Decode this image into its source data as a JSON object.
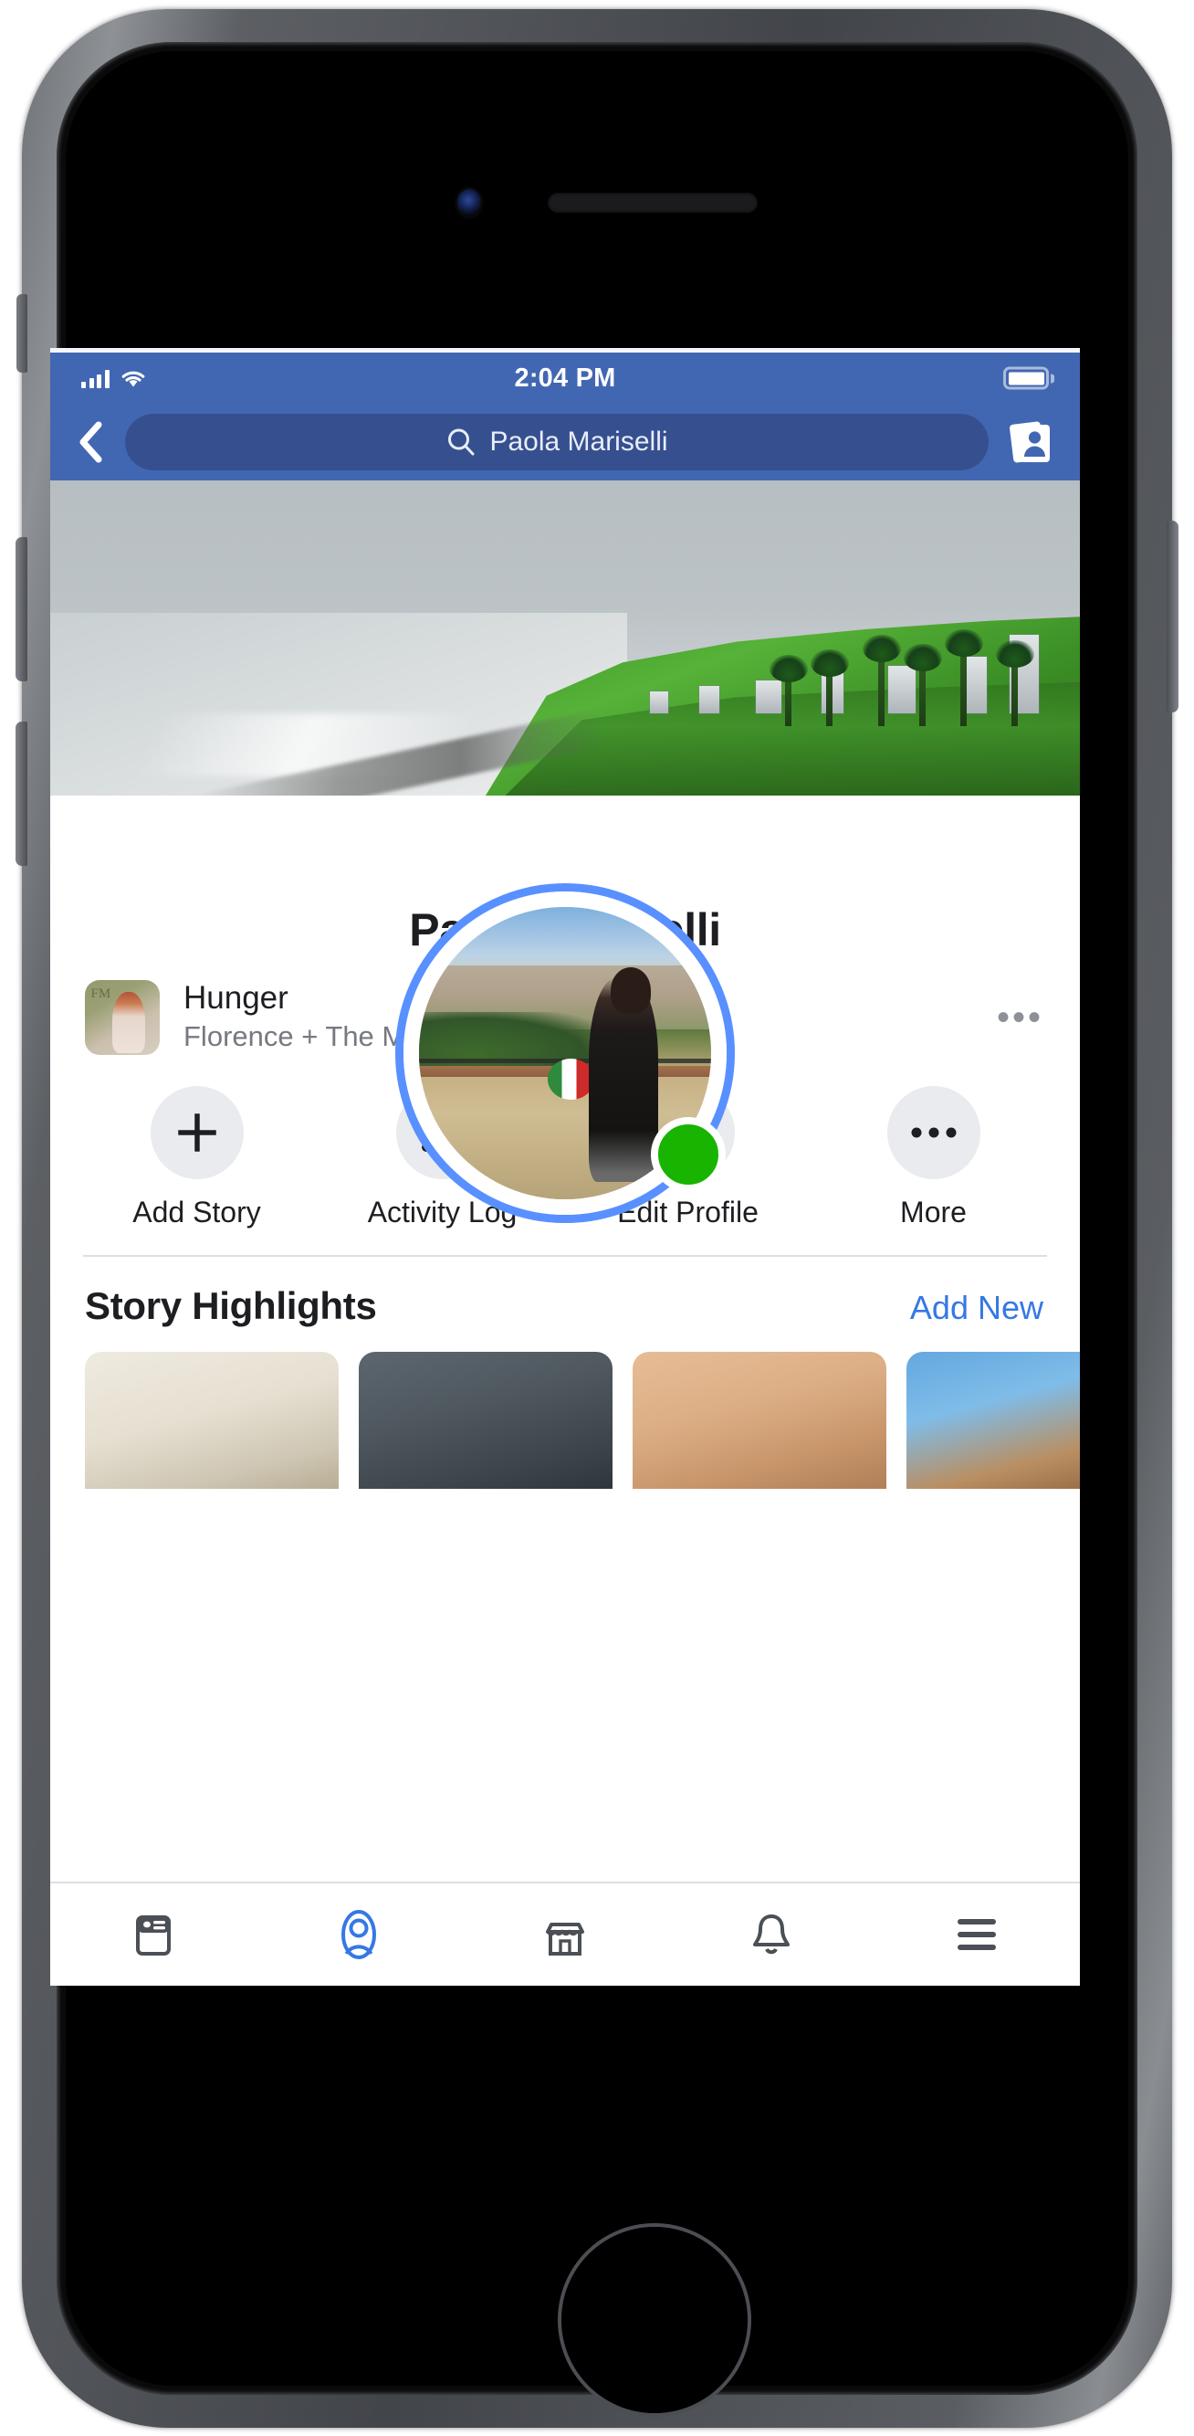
{
  "device": {
    "frame": "iphone-8",
    "hardware": {
      "camera": "front-camera",
      "speaker": "earpiece-speaker",
      "home_button": "home-button",
      "silent_switch": "silent-switch",
      "volume_up": "volume-up-button",
      "volume_down": "volume-down-button",
      "power": "power-button"
    }
  },
  "statusbar": {
    "signal_icon": "cellular-signal-icon",
    "signal_bars": 4,
    "wifi_icon": "wifi-icon",
    "time": "2:04 PM",
    "battery_icon": "battery-full-icon",
    "battery_level": 100,
    "background_color": "#4267b2"
  },
  "navbar": {
    "back_icon": "back-chevron-icon",
    "search": {
      "icon": "search-icon",
      "value": "Paola Mariselli",
      "placeholder": "Search"
    },
    "friend_requests_icon": "friend-requests-icon",
    "background_color": "#4267b2",
    "pill_color": "#36508f"
  },
  "cover": {
    "alt": "coastal cliff city view cover photo"
  },
  "profile": {
    "avatar_alt": "woman standing on terrace overlooking Florence",
    "ring_color": "#5890ff",
    "online_status": "online",
    "online_color": "#18b400",
    "name": "Paola Mariselli"
  },
  "music": {
    "album_art_alt": "Florence + The Machine High as Hope album cover",
    "album_monogram": "FM",
    "title": "Hunger",
    "artist": "Florence + The Machine",
    "options_icon": "more-options-icon"
  },
  "actions": [
    {
      "icon": "plus-icon",
      "label": "Add Story"
    },
    {
      "icon": "list-icon",
      "label": "Activity Log"
    },
    {
      "icon": "pencil-icon",
      "label": "Edit Profile"
    },
    {
      "icon": "ellipsis-icon",
      "label": "More"
    }
  ],
  "story_highlights": {
    "title": "Story Highlights",
    "add_new_label": "Add New",
    "add_new_color": "#3578e5",
    "cards": [
      {
        "alt": "cream textured highlight"
      },
      {
        "alt": "grey denim highlight"
      },
      {
        "alt": "tan fabric highlight"
      },
      {
        "alt": "blue sky highlight"
      }
    ]
  },
  "tabbar": {
    "active_color": "#3578e5",
    "inactive_color": "#4b4f56",
    "items": [
      {
        "icon": "news-feed-icon",
        "label": "News Feed",
        "active": false
      },
      {
        "icon": "profile-icon",
        "label": "Profile",
        "active": true
      },
      {
        "icon": "marketplace-icon",
        "label": "Marketplace",
        "active": false
      },
      {
        "icon": "notifications-bell-icon",
        "label": "Notifications",
        "active": false
      },
      {
        "icon": "menu-hamburger-icon",
        "label": "Menu",
        "active": false
      }
    ]
  }
}
